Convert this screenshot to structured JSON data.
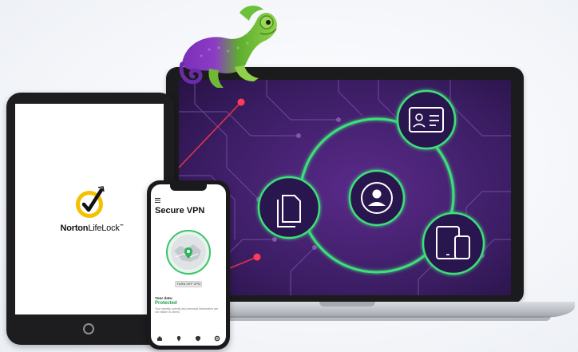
{
  "brand": {
    "name": "NortonLifeLock",
    "name_part1": "Norton",
    "name_part2": "LifeLock",
    "trademark": "™",
    "logo_icon": "norton-checkmark-seal-icon",
    "logo_color": "#f5c000"
  },
  "phone_app": {
    "title": "Secure VPN",
    "menu_icon": "hamburger-menu-icon",
    "map_icon": "vpn-location-map-icon",
    "vpn_button_label": "TURN OFF VPN",
    "data_label": "Your data:",
    "status": "Protected",
    "status_color": "#20a04a",
    "description": "Your identity, activity and personal information are not visible to others",
    "tabs": [
      {
        "icon": "home-icon"
      },
      {
        "icon": "location-pin-icon"
      },
      {
        "icon": "shield-icon"
      },
      {
        "icon": "settings-icon"
      }
    ]
  },
  "laptop_screen": {
    "background_color": "#3b1d63",
    "ring_color": "#3de07a",
    "nodes": [
      {
        "icon": "user-avatar-icon"
      },
      {
        "icon": "id-card-icon"
      },
      {
        "icon": "documents-icon"
      },
      {
        "icon": "devices-icon"
      }
    ]
  },
  "decor": {
    "mascot_icon": "chameleon-mascot-icon"
  }
}
